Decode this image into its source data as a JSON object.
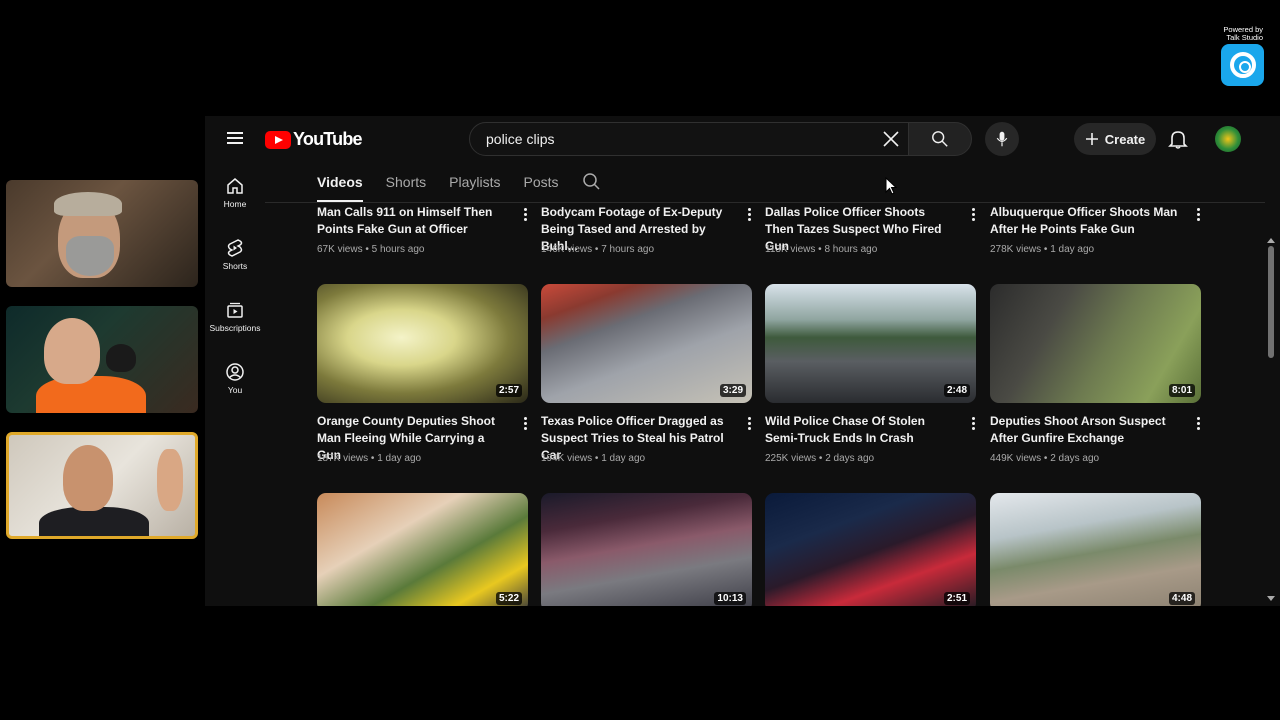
{
  "badge": {
    "line1": "Powered by",
    "line2": "Talk Studio"
  },
  "youtube": {
    "logo_text": "YouTube",
    "search": {
      "value": "police clips"
    },
    "create_label": "Create",
    "nav": [
      {
        "label": "Home",
        "icon": "home-icon"
      },
      {
        "label": "Shorts",
        "icon": "shorts-icon"
      },
      {
        "label": "Subscriptions",
        "icon": "subscriptions-icon"
      },
      {
        "label": "You",
        "icon": "you-icon"
      }
    ],
    "tabs": [
      "Videos",
      "Shorts",
      "Playlists",
      "Posts"
    ],
    "active_tab": "Videos",
    "rows": [
      [
        {
          "title": "Man Calls 911 on Himself Then Points Fake Gun at Officer",
          "meta": "67K views • 5 hours ago"
        },
        {
          "title": "Bodycam Footage of Ex-Deputy Being Tased and Arrested by Buhl...",
          "meta": "146K views • 7 hours ago"
        },
        {
          "title": "Dallas Police Officer Shoots Then Tazes Suspect Who Fired Gun",
          "meta": "113K views • 8 hours ago"
        },
        {
          "title": "Albuquerque Officer Shoots Man After He Points Fake Gun",
          "meta": "278K views • 1 day ago"
        }
      ],
      [
        {
          "title": "Orange County Deputies Shoot Man Fleeing While Carrying a Gun",
          "meta": "187K views • 1 day ago",
          "duration": "2:57"
        },
        {
          "title": "Texas Police Officer Dragged as Suspect Tries to Steal his Patrol Car",
          "meta": "194K views • 1 day ago",
          "duration": "3:29"
        },
        {
          "title": "Wild Police Chase Of Stolen Semi-Truck Ends In Crash",
          "meta": "225K views • 2 days ago",
          "duration": "2:48"
        },
        {
          "title": "Deputies Shoot Arson Suspect After Gunfire Exchange",
          "meta": "449K views • 2 days ago",
          "duration": "8:01"
        }
      ],
      [
        {
          "duration": "5:22"
        },
        {
          "duration": "10:13"
        },
        {
          "duration": "2:51"
        },
        {
          "duration": "4:48"
        }
      ]
    ]
  }
}
